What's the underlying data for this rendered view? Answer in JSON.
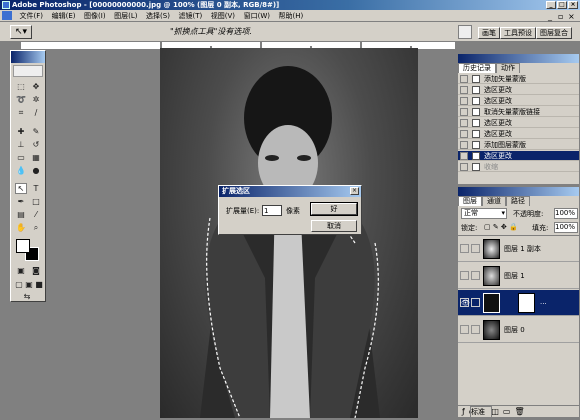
{
  "window": {
    "title": "Adobe Photoshop - [00000000000.jpg @ 100% (图层 0 副本, RGB/8#)]"
  },
  "menu": [
    "文件(F)",
    "编辑(E)",
    "图像(I)",
    "图层(L)",
    "选择(S)",
    "滤镜(T)",
    "视图(V)",
    "窗口(W)",
    "帮助(H)"
  ],
  "options": {
    "hint": "\"抓换点工具\"没有选项.",
    "tabs": [
      "画笔",
      "工具预设",
      "图层复合"
    ]
  },
  "dialog": {
    "title": "扩展选区",
    "field_label": "扩展量(E):",
    "field_value": "1",
    "unit": "像素",
    "ok_label": "好",
    "cancel_label": "取消"
  },
  "history": {
    "tabs": [
      "历史记录",
      "动作"
    ],
    "items": [
      {
        "label": "添加矢量蒙版"
      },
      {
        "label": "选区更改"
      },
      {
        "label": "选区更改"
      },
      {
        "label": "取消矢量蒙版链接"
      },
      {
        "label": "选区更改"
      },
      {
        "label": "选区更改"
      },
      {
        "label": "添加图层蒙版"
      },
      {
        "label": "选区更改"
      },
      {
        "label": "收缩"
      }
    ],
    "selected_index": 7
  },
  "layers": {
    "tabs": [
      "图层",
      "通道",
      "路径"
    ],
    "blend_mode": "正常",
    "opacity_label": "不透明度:",
    "opacity_value": "100%",
    "lock_label": "锁定:",
    "fill_label": "填充:",
    "fill_value": "100%",
    "items": [
      {
        "name": "图层 1 副本"
      },
      {
        "name": "图层 1"
      },
      {
        "name": "..."
      },
      {
        "name": "图层 0"
      }
    ],
    "selected_index": 2
  },
  "status": {
    "label": "标准"
  }
}
